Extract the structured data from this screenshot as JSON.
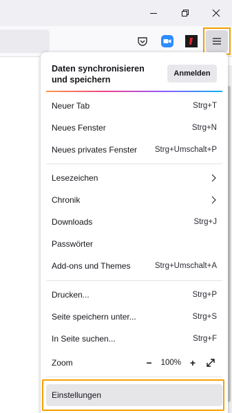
{
  "colors": {
    "highlight": "#f4a000",
    "panel_bg": "#ffffff",
    "toolbar_bg": "#f9f9fb"
  },
  "window_controls": {
    "minimize_icon": "minimize-icon",
    "restore_icon": "restore-icon",
    "close_icon": "close-icon"
  },
  "toolbar": {
    "icons": [
      "pocket-icon",
      "zoom-extension-icon",
      "font-extension-icon",
      "hamburger-menu-icon"
    ]
  },
  "menu": {
    "sync_text": "Daten synchronisieren und speichern",
    "signin_label": "Anmelden",
    "items": [
      {
        "label": "Neuer Tab",
        "shortcut": "Strg+T"
      },
      {
        "label": "Neues Fenster",
        "shortcut": "Strg+N"
      },
      {
        "label": "Neues privates Fenster",
        "shortcut": "Strg+Umschalt+P"
      },
      {
        "label": "Lesezeichen",
        "shortcut": ""
      },
      {
        "label": "Chronik",
        "shortcut": ""
      },
      {
        "label": "Downloads",
        "shortcut": "Strg+J"
      },
      {
        "label": "Passwörter",
        "shortcut": ""
      },
      {
        "label": "Add-ons und Themes",
        "shortcut": "Strg+Umschalt+A"
      },
      {
        "label": "Drucken...",
        "shortcut": "Strg+P"
      },
      {
        "label": "Seite speichern unter...",
        "shortcut": "Strg+S"
      },
      {
        "label": "In Seite suchen...",
        "shortcut": "Strg+F"
      }
    ],
    "zoom": {
      "label": "Zoom",
      "minus": "−",
      "value": "100%",
      "plus": "+"
    },
    "settings_label": "Einstellungen"
  }
}
